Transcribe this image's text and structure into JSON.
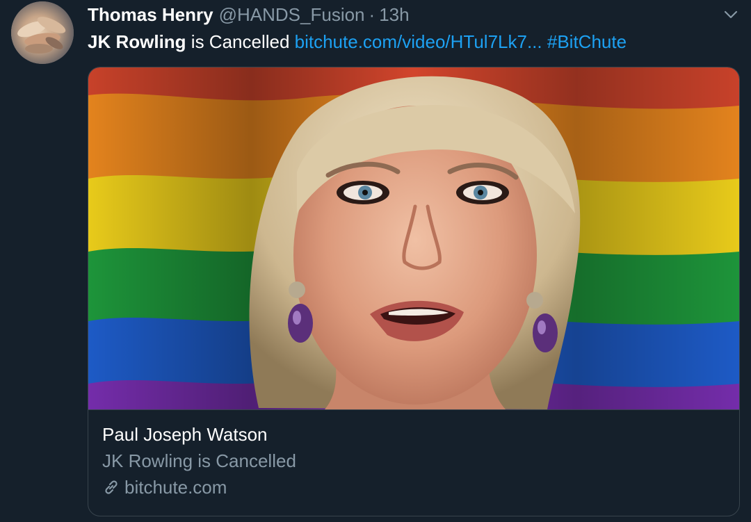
{
  "tweet": {
    "display_name": "Thomas Henry",
    "handle": "@HANDS_Fusion",
    "separator": "·",
    "time": "13h",
    "text_bold": "JK Rowling",
    "text_plain": " is Cancelled ",
    "link_text": "bitchute.com/video/HTul7Lk7...",
    "hashtag": "#BitChute"
  },
  "card": {
    "title": "Paul Joseph Watson",
    "description": "JK Rowling is Cancelled",
    "domain": "bitchute.com"
  },
  "icons": {
    "menu": "chevron-down-icon",
    "link": "link-icon"
  },
  "colors": {
    "background": "#15202b",
    "link": "#1da1f2",
    "secondary_text": "#8899a6",
    "border": "#38444d"
  }
}
